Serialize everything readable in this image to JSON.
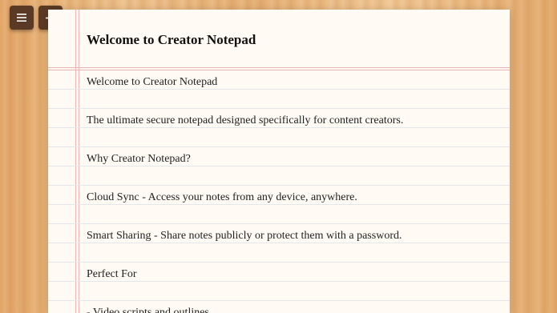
{
  "toolbar": {
    "menu_icon": "hamburger-menu-icon",
    "add_icon": "plus-icon",
    "button_color": "#5a3a24"
  },
  "note": {
    "title": "Welcome to Creator Notepad",
    "lines": [
      "Welcome to Creator Notepad",
      "The ultimate secure notepad designed specifically for content creators.",
      "Why Creator Notepad?",
      "Cloud Sync - Access your notes from any device, anywhere.",
      "Smart Sharing - Share notes publicly or protect them with a password.",
      "Perfect For",
      "- Video scripts and outlines"
    ]
  }
}
